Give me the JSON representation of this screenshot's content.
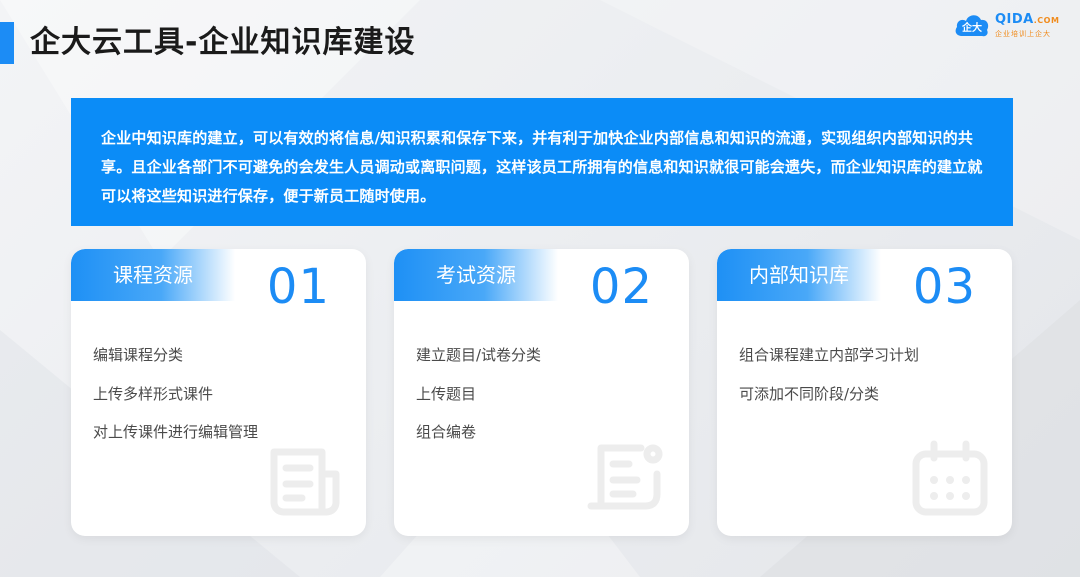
{
  "page": {
    "title": "企大云工具-企业知识库建设"
  },
  "logo": {
    "brand": "QIDA",
    "domain": ".COM",
    "slogan": "企业培训上企大",
    "icon": "cloud-logo-icon"
  },
  "intro": {
    "text": "企业中知识库的建立，可以有效的将信息/知识积累和保存下来，并有利于加快企业内部信息和知识的流通，实现组织内部知识的共享。且企业各部门不可避免的会发生人员调动或离职问题，这样该员工所拥有的信息和知识就很可能会遗失，而企业知识库的建立就可以将这些知识进行保存，便于新员工随时使用。"
  },
  "cards": [
    {
      "label": "课程资源",
      "number": "01",
      "items": [
        "编辑课程分类",
        "上传多样形式课件",
        "对上传课件进行编辑管理"
      ],
      "icon": "document-icon"
    },
    {
      "label": "考试资源",
      "number": "02",
      "items": [
        "建立题目/试卷分类",
        "上传题目",
        "组合编卷"
      ],
      "icon": "exam-paper-icon"
    },
    {
      "label": "内部知识库",
      "number": "03",
      "items": [
        "组合课程建立内部学习计划",
        "可添加不同阶段/分类"
      ],
      "icon": "calendar-icon"
    }
  ],
  "colors": {
    "accent": "#1c8cf5",
    "intro_bg": "#0b8cf7",
    "logo_orange": "#f08c1e"
  }
}
